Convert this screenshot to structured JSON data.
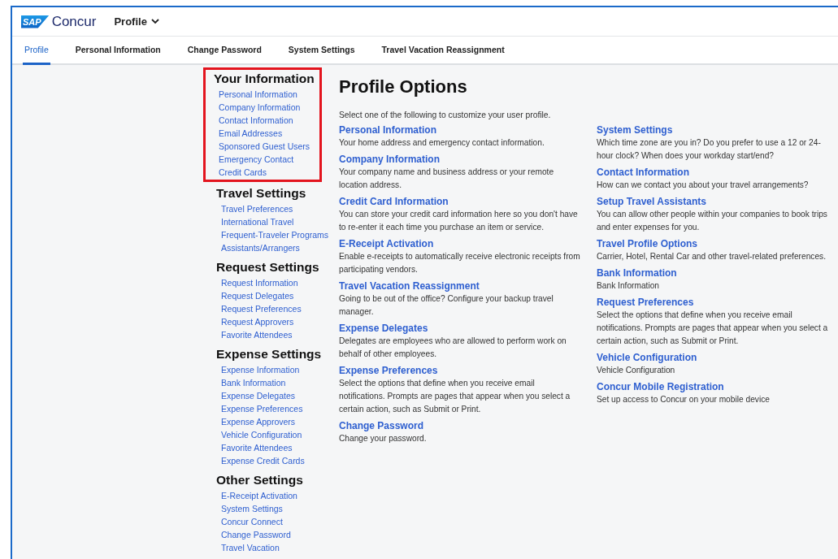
{
  "header": {
    "logo": {
      "badge": "SAP",
      "name": "Concur"
    },
    "module_menu": {
      "label": "Profile"
    }
  },
  "tabs": [
    {
      "label": "Profile",
      "selected": true
    },
    {
      "label": "Personal Information",
      "selected": false
    },
    {
      "label": "Change Password",
      "selected": false
    },
    {
      "label": "System Settings",
      "selected": false
    },
    {
      "label": "Travel Vacation Reassignment",
      "selected": false
    }
  ],
  "sidebar": {
    "sections": [
      {
        "title": "Your Information",
        "highlighted": true,
        "links": [
          "Personal Information",
          "Company Information",
          "Contact Information",
          "Email Addresses",
          "Sponsored Guest Users",
          "Emergency Contact",
          "Credit Cards"
        ]
      },
      {
        "title": "Travel Settings",
        "highlighted": false,
        "links": [
          "Travel Preferences",
          "International Travel",
          "Frequent-Traveler Programs",
          "Assistants/Arrangers"
        ]
      },
      {
        "title": "Request Settings",
        "highlighted": false,
        "links": [
          "Request Information",
          "Request Delegates",
          "Request Preferences",
          "Request Approvers",
          "Favorite Attendees"
        ]
      },
      {
        "title": "Expense Settings",
        "highlighted": false,
        "links": [
          "Expense Information",
          "Bank Information",
          "Expense Delegates",
          "Expense Preferences",
          "Expense Approvers",
          "Vehicle Configuration",
          "Favorite Attendees",
          "Expense Credit Cards"
        ]
      },
      {
        "title": "Other Settings",
        "highlighted": false,
        "links": [
          "E-Receipt Activation",
          "System Settings",
          "Concur Connect",
          "Change Password",
          "Travel Vacation"
        ]
      }
    ]
  },
  "main": {
    "title": "Profile Options",
    "intro": "Select one of the following to customize your user profile.",
    "columns": [
      [
        {
          "title": "Personal Information",
          "description": "Your home address and emergency contact information."
        },
        {
          "title": "Company Information",
          "description": "Your company name and business address or your remote location address."
        },
        {
          "title": "Credit Card Information",
          "description": "You can store your credit card information here so you don't have to re-enter it each time you purchase an item or service."
        },
        {
          "title": "E-Receipt Activation",
          "description": "Enable e-receipts to automatically receive electronic receipts from participating vendors."
        },
        {
          "title": "Travel Vacation Reassignment",
          "description": "Going to be out of the office? Configure your backup travel manager."
        },
        {
          "title": "Expense Delegates",
          "description": "Delegates are employees who are allowed to perform work on behalf of other employees."
        },
        {
          "title": "Expense Preferences",
          "description": "Select the options that define when you receive email notifications. Prompts are pages that appear when you select a certain action, such as Submit or Print."
        },
        {
          "title": "Change Password",
          "description": "Change your password."
        }
      ],
      [
        {
          "title": "System Settings",
          "description": "Which time zone are you in? Do you prefer to use a 12 or 24-hour clock? When does your workday start/end?"
        },
        {
          "title": "Contact Information",
          "description": "How can we contact you about your travel arrangements?"
        },
        {
          "title": "Setup Travel Assistants",
          "description": "You can allow other people within your companies to book trips and enter expenses for you."
        },
        {
          "title": "Travel Profile Options",
          "description": "Carrier, Hotel, Rental Car and other travel-related preferences."
        },
        {
          "title": "Bank Information",
          "description": "Bank Information"
        },
        {
          "title": "Request Preferences",
          "description": "Select the options that define when you receive email notifications. Prompts are pages that appear when you select a certain action, such as Submit or Print."
        },
        {
          "title": "Vehicle Configuration",
          "description": "Vehicle Configuration"
        },
        {
          "title": "Concur Mobile Registration",
          "description": "Set up access to Concur on your mobile device"
        }
      ]
    ]
  }
}
